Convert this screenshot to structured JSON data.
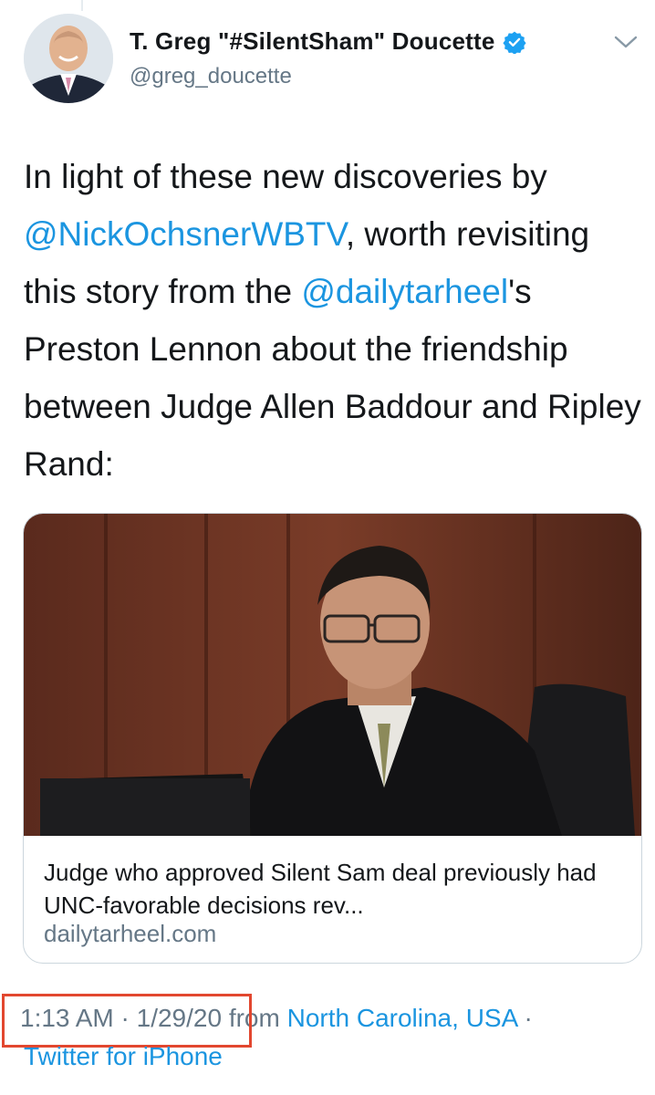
{
  "author": {
    "display_name": "T. Greg \"#SilentSham\" Doucette",
    "handle": "@greg_doucette",
    "verified": true,
    "verified_icon": "verified-badge-icon"
  },
  "tweet": {
    "segments": [
      {
        "type": "text",
        "text": "In light of these new discoveries by "
      },
      {
        "type": "mention",
        "text": "@NickOchsnerWBTV"
      },
      {
        "type": "text",
        "text": ", worth revisiting this story from the "
      },
      {
        "type": "mention",
        "text": "@dailytarheel"
      },
      {
        "type": "text",
        "text": "'s Preston Lennon about the friendship between Judge Allen Baddour and Ripley Rand:"
      }
    ]
  },
  "card": {
    "image": "judge-photo",
    "title": "Judge who approved Silent Sam deal previously had UNC-favorable decisions rev...",
    "domain": "dailytarheel.com"
  },
  "meta": {
    "time": "1:13 AM",
    "separator": " · ",
    "date": "1/29/20",
    "from_text": " from ",
    "location": "North Carolina, USA",
    "trailing_separator": " ·",
    "source": "Twitter for iPhone"
  },
  "colors": {
    "link": "#1b95e0",
    "secondary_text": "#657786",
    "highlight_box": "#e2472f",
    "card_border": "#ccd6dd"
  },
  "icons": [
    "caret-down-icon",
    "verified-badge-icon"
  ]
}
